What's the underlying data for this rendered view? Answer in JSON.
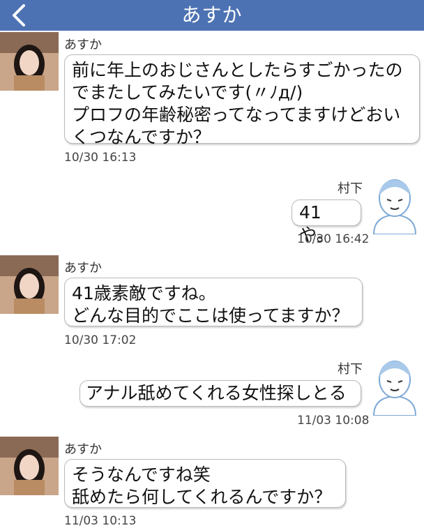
{
  "header": {
    "title": "あすか",
    "back_icon": "chevron-left-icon",
    "bg_color": "#4d72b3"
  },
  "messages": [
    {
      "sender": "あすか",
      "text": "前に年上のおじさんとしたらすごかったの\nでまたしてみたいです(〃ﾉд/)\nプロフの年齢秘密ってなってますけどおい\nくつなんですか？",
      "time": "10/30 16:13"
    },
    {
      "sender": "村下",
      "text": "41や。",
      "time": "10/30 16:42"
    },
    {
      "sender": "あすか",
      "text": "41歳素敵ですね。\nどんな目的でここは使ってますか？",
      "time": "10/30 17:02"
    },
    {
      "sender": "村下",
      "text": "アナル舐めてくれる女性探しとる",
      "time": "11/03 10:08"
    },
    {
      "sender": "あすか",
      "text": "そうなんですね笑\n舐めたら何してくれるんですか？",
      "time": "11/03 10:13"
    }
  ]
}
